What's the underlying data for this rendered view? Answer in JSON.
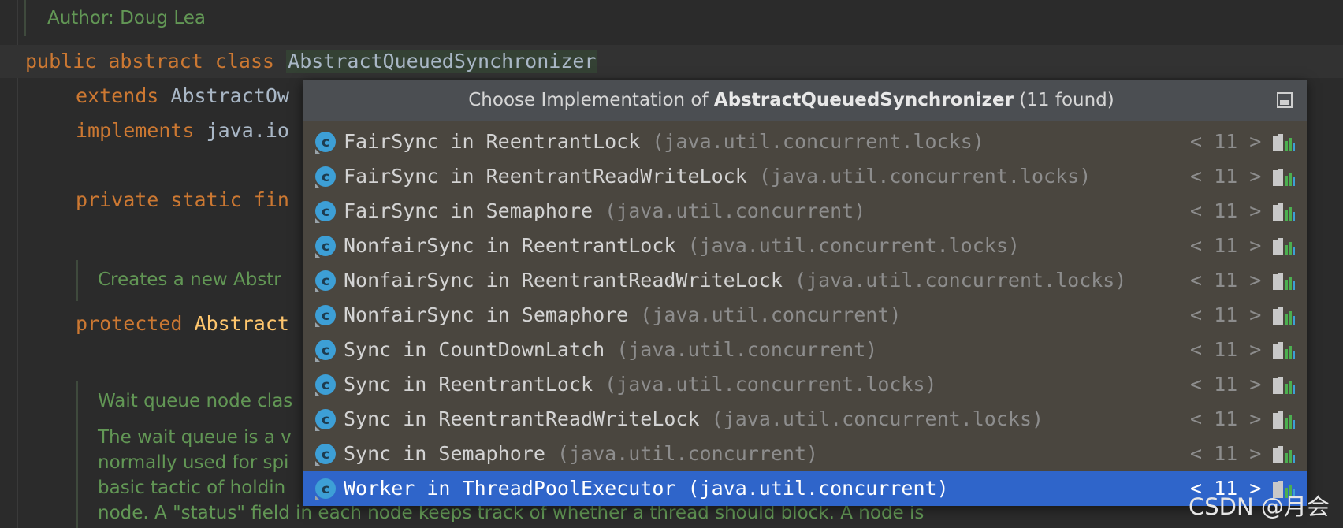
{
  "editor": {
    "author_line": "Author: Doug Lea",
    "class_decl": {
      "modifiers": "public abstract class",
      "class_name": "AbstractQueuedSynchronizer"
    },
    "extends_kw": "extends",
    "extends_text": "AbstractOw",
    "implements_kw": "implements",
    "implements_text": "java.io",
    "field_kw": "private static fin",
    "doc1": "Creates a new Abstr",
    "ctor_kw": "protected",
    "ctor_name": "Abstract",
    "doc2_title": "Wait queue node clas",
    "doc2_lines": [
      "The wait queue is a v",
      "normally used for spi",
      "basic tactic of holdin",
      "node. A \"status\" field in each node keeps track of whether a thread should block. A node is"
    ]
  },
  "popup": {
    "title_prefix": "Choose Implementation of ",
    "title_class": "AbstractQueuedSynchronizer",
    "title_suffix": " (11 found)",
    "nav_text": "< 11 >",
    "items": [
      {
        "name": "FairSync in ReentrantLock",
        "pkg": "(java.util.concurrent.locks)",
        "selected": false
      },
      {
        "name": "FairSync in ReentrantReadWriteLock",
        "pkg": "(java.util.concurrent.locks)",
        "selected": false
      },
      {
        "name": "FairSync in Semaphore",
        "pkg": "(java.util.concurrent)",
        "selected": false
      },
      {
        "name": "NonfairSync in ReentrantLock",
        "pkg": "(java.util.concurrent.locks)",
        "selected": false
      },
      {
        "name": "NonfairSync in ReentrantReadWriteLock",
        "pkg": "(java.util.concurrent.locks)",
        "selected": false
      },
      {
        "name": "NonfairSync in Semaphore",
        "pkg": "(java.util.concurrent)",
        "selected": false
      },
      {
        "name": "Sync in CountDownLatch",
        "pkg": "(java.util.concurrent)",
        "selected": false
      },
      {
        "name": "Sync in ReentrantLock",
        "pkg": "(java.util.concurrent.locks)",
        "selected": false
      },
      {
        "name": "Sync in ReentrantReadWriteLock",
        "pkg": "(java.util.concurrent.locks)",
        "selected": false
      },
      {
        "name": "Sync in Semaphore",
        "pkg": "(java.util.concurrent)",
        "selected": false
      },
      {
        "name": "Worker in ThreadPoolExecutor",
        "pkg": "(java.util.concurrent)",
        "selected": true
      }
    ]
  },
  "watermark": "CSDN @月会",
  "colors": {
    "keyword": "#cc7832",
    "doc_comment": "#629755",
    "selection": "#2f65ca",
    "class_icon": "#3d9fd6"
  }
}
